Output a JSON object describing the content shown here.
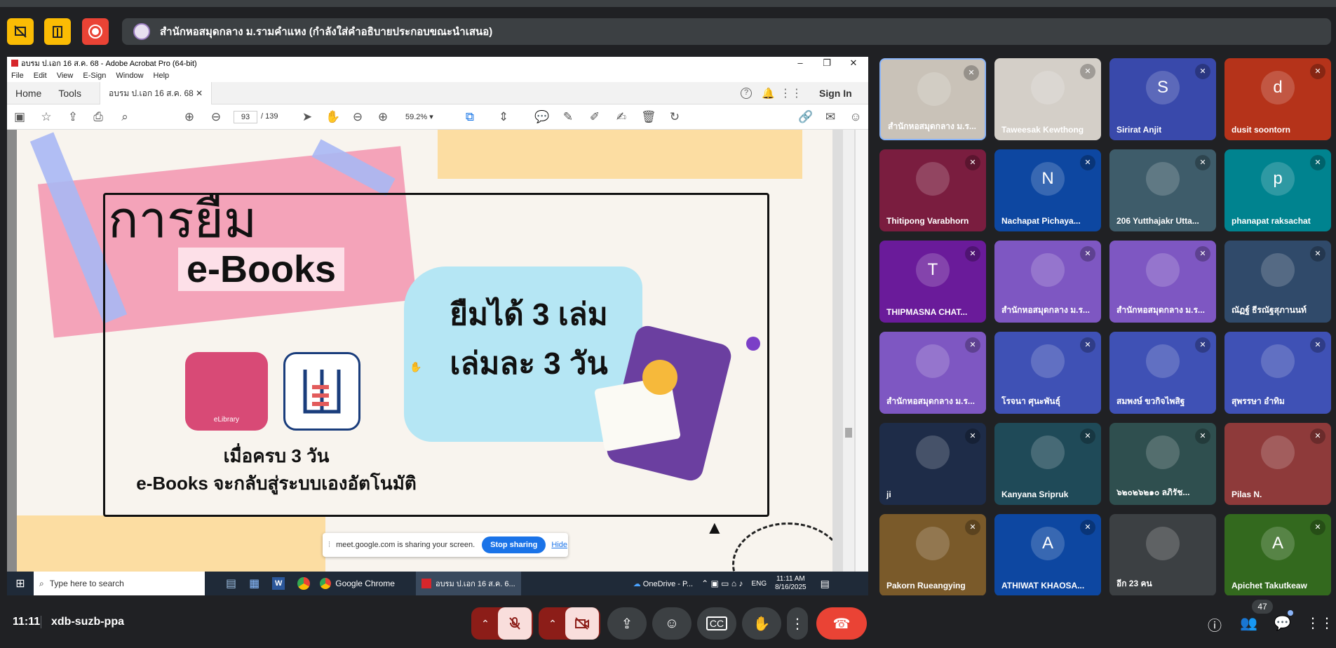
{
  "banner": {
    "text": "สำนักหอสมุดกลาง ม.รามคำแหง (กำลังใส่คำอธิบายประกอบขณะนำเสนอ)"
  },
  "acrobat": {
    "title": "อบรม ป.เอก 16 ส.ค. 68 - Adobe Acrobat Pro (64-bit)",
    "menus": [
      "File",
      "Edit",
      "View",
      "E-Sign",
      "Window",
      "Help"
    ],
    "tabs": {
      "home": "Home",
      "tools": "Tools",
      "doc": "อบรม ป.เอก 16 ส.ค. 68"
    },
    "sign_in": "Sign In",
    "page_current": "93",
    "page_total": "/ 139",
    "zoom": "59.2%"
  },
  "slide": {
    "heading1": "การยืม",
    "heading2": "e-Books",
    "borrow_line1": "ยืมได้ 3 เล่ม",
    "borrow_line2": "เล่มละ 3 วัน",
    "return_line1": "เมื่อครบ 3 วัน",
    "return_line2": "e-Books จะกลับสู่ระบบเองอัตโนมัติ",
    "logo_label": "eLibrary"
  },
  "share_notice": {
    "text": "meet.google.com is sharing your screen.",
    "stop": "Stop sharing",
    "hide": "Hide"
  },
  "taskbar": {
    "search_placeholder": "Type here to search",
    "chrome": "Google Chrome",
    "acrobat": "อบรม ป.เอก 16 ส.ค. 6...",
    "onedrive": "OneDrive - P...",
    "lang": "ENG",
    "time": "11:11 AM",
    "date": "8/16/2025"
  },
  "meeting": {
    "time": "11:11",
    "code": "xdb-suzb-ppa",
    "people_count": "47"
  },
  "participants": [
    {
      "name": "สำนักหอสมุดกลาง ม.ร...",
      "initial": "",
      "bg": "#c9c2b8"
    },
    {
      "name": "Taweesak Kewthong",
      "initial": "",
      "bg": "#d4cfc8"
    },
    {
      "name": "Sirirat Anjit",
      "initial": "S",
      "bg": "#3949ab"
    },
    {
      "name": "dusit soontorn",
      "initial": "d",
      "bg": "#b5331a"
    },
    {
      "name": "Thitipong Varabhorn",
      "initial": "",
      "bg": "#7a1d3f"
    },
    {
      "name": "Nachapat Pichaya...",
      "initial": "N",
      "bg": "#0d47a1"
    },
    {
      "name": "206 Yutthajakr Utta...",
      "initial": "",
      "bg": "#3e5c6a"
    },
    {
      "name": "phanapat raksachat",
      "initial": "p",
      "bg": "#00838f"
    },
    {
      "name": "THIPMASNA CHAT...",
      "initial": "T",
      "bg": "#6a1b9a"
    },
    {
      "name": "สำนักหอสมุดกลาง ม.ร...",
      "initial": "",
      "bg": "#7e57c2"
    },
    {
      "name": "สำนักหอสมุดกลาง ม.ร...",
      "initial": "",
      "bg": "#7e57c2"
    },
    {
      "name": "ณัฏฐ์ ธีรณัฐสุภานนท์",
      "initial": "",
      "bg": "#304a6a"
    },
    {
      "name": "สำนักหอสมุดกลาง ม.ร...",
      "initial": "",
      "bg": "#7e57c2"
    },
    {
      "name": "โรจนา ศุนะพันธุ์",
      "initial": "",
      "bg": "#3f51b5"
    },
    {
      "name": "สมพงษ์ ขวกิจไพสิฐ",
      "initial": "",
      "bg": "#3f51b5"
    },
    {
      "name": "สุพรรษา อำทิม",
      "initial": "",
      "bg": "#3f51b5"
    },
    {
      "name": "ji",
      "initial": "",
      "bg": "#1e2c48"
    },
    {
      "name": "Kanyana Sripruk",
      "initial": "",
      "bg": "#1f4a58"
    },
    {
      "name": "๖๒๐๒๖๒๑๐ ลภิรัช...",
      "initial": "",
      "bg": "#2f4f4f"
    },
    {
      "name": "Pilas N.",
      "initial": "",
      "bg": "#8e3a3a"
    },
    {
      "name": "Pakorn Rueangying",
      "initial": "",
      "bg": "#7a5a2a"
    },
    {
      "name": "ATHIWAT KHAOSA...",
      "initial": "A",
      "bg": "#0d47a1"
    },
    {
      "name": "อีก 23 คน",
      "initial": "",
      "bg": "#3c4043"
    },
    {
      "name": "Apichet Takutkeaw",
      "initial": "A",
      "bg": "#33691e"
    }
  ]
}
